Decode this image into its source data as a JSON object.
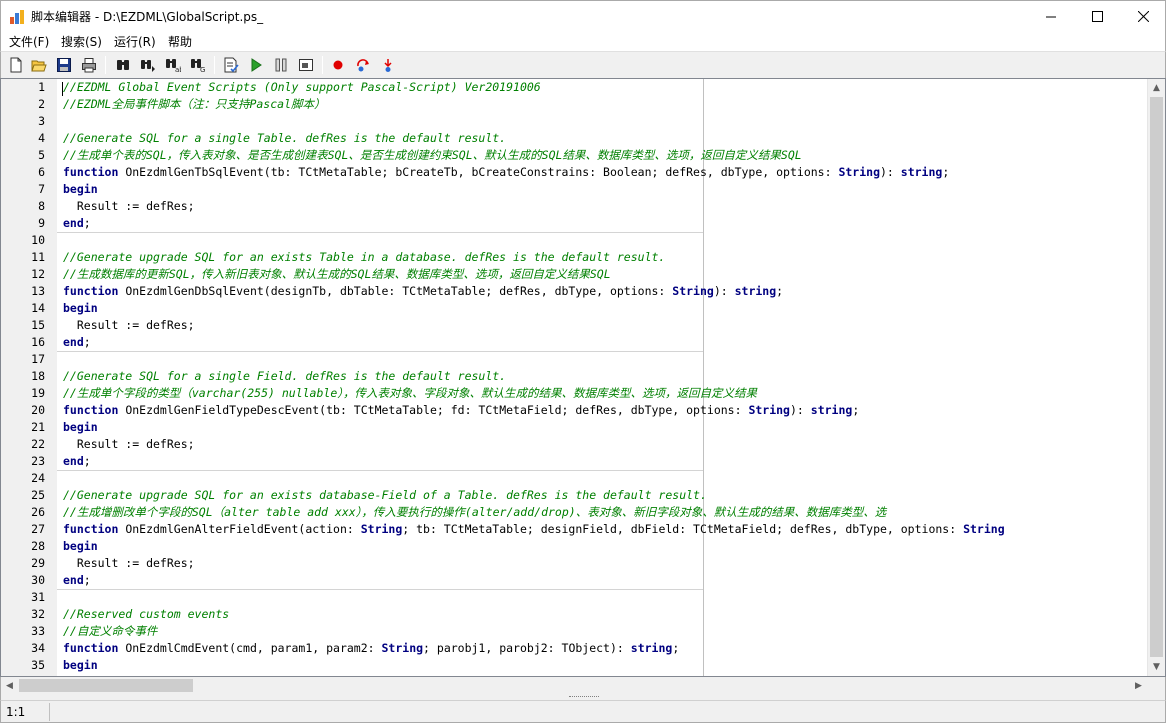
{
  "window": {
    "title": "脚本编辑器 - D:\\EZDML\\GlobalScript.ps_",
    "minimize_label": "—",
    "maximize_label": "☐",
    "close_label": "✕"
  },
  "menu": [
    {
      "label": "文件(F)"
    },
    {
      "label": "搜索(S)"
    },
    {
      "label": "运行(R)"
    },
    {
      "label": "帮助"
    }
  ],
  "toolbar": {
    "icons": [
      "new-file-icon",
      "open-folder-icon",
      "save-icon",
      "print-icon",
      "find-icon",
      "find-next-icon",
      "replace-icon",
      "goto-line-icon",
      "syntax-check-icon",
      "run-icon",
      "pause-icon",
      "step-into-icon",
      "breakpoint-icon",
      "step-over-icon",
      "trace-icon"
    ],
    "colors": {
      "run": "#2aa02a",
      "breakpoint": "#e00000"
    }
  },
  "editor": {
    "line_numbers": [
      "1",
      "2",
      "3",
      "4",
      "5",
      "6",
      "7",
      "8",
      "9",
      "10",
      "11",
      "12",
      "13",
      "14",
      "15",
      "16",
      "17",
      "18",
      "19",
      "20",
      "21",
      "22",
      "23",
      "24",
      "25",
      "26",
      "27",
      "28",
      "29",
      "30",
      "31",
      "32",
      "33",
      "34",
      "35"
    ],
    "lines": [
      {
        "comment": "//EZDML Global Event Scripts (Only support Pascal-Script) Ver20191006"
      },
      {
        "comment": "//EZDML全局事件脚本（注：只支持Pascal脚本）"
      },
      {
        "plain": ""
      },
      {
        "comment": "//Generate SQL for a single Table. defRes is the default result."
      },
      {
        "comment": "//生成单个表的SQL，传入表对象、是否生成创建表SQL、是否生成创建约束SQL、默认生成的SQL结果、数据库类型、选项，返回自定义结果SQL"
      },
      {
        "kw": "function",
        "plain": " OnEzdmlGenTbSqlEvent(tb: TCtMetaTable; bCreateTb, bCreateConstrains: Boolean; defRes, dbType, options: ",
        "kw2": "String",
        "plain2": "): ",
        "kw3": "string",
        "plain3": ";"
      },
      {
        "kw": "begin"
      },
      {
        "plain": "  Result := defRes;"
      },
      {
        "kw": "end",
        "plain": ";"
      },
      {
        "plain": ""
      },
      {
        "comment": "//Generate upgrade SQL for an exists Table in a database. defRes is the default result."
      },
      {
        "comment": "//生成数据库的更新SQL，传入新旧表对象、默认生成的SQL结果、数据库类型、选项，返回自定义结果SQL"
      },
      {
        "kw": "function",
        "plain": " OnEzdmlGenDbSqlEvent(designTb, dbTable: TCtMetaTable; defRes, dbType, options: ",
        "kw2": "String",
        "plain2": "): ",
        "kw3": "string",
        "plain3": ";"
      },
      {
        "kw": "begin"
      },
      {
        "plain": "  Result := defRes;"
      },
      {
        "kw": "end",
        "plain": ";"
      },
      {
        "plain": ""
      },
      {
        "comment": "//Generate SQL for a single Field. defRes is the default result."
      },
      {
        "comment": "//生成单个字段的类型（varchar(255) nullable），传入表对象、字段对象、默认生成的结果、数据库类型、选项，返回自定义结果"
      },
      {
        "kw": "function",
        "plain": " OnEzdmlGenFieldTypeDescEvent(tb: TCtMetaTable; fd: TCtMetaField; defRes, dbType, options: ",
        "kw2": "String",
        "plain2": "): ",
        "kw3": "string",
        "plain3": ";"
      },
      {
        "kw": "begin"
      },
      {
        "plain": "  Result := defRes;"
      },
      {
        "kw": "end",
        "plain": ";"
      },
      {
        "plain": ""
      },
      {
        "comment": "//Generate upgrade SQL for an exists database-Field of a Table. defRes is the default result."
      },
      {
        "comment": "//生成增删改单个字段的SQL（alter table add xxx），传入要执行的操作(alter/add/drop)、表对象、新旧字段对象、默认生成的结果、数据库类型、选"
      },
      {
        "kw": "function",
        "plain": " OnEzdmlGenAlterFieldEvent(action: ",
        "kw2": "String",
        "plain2": "; tb: TCtMetaTable; designField, dbField: TCtMetaField; defRes, dbType, options: ",
        "kw3": "String",
        "plain3": ""
      },
      {
        "kw": "begin"
      },
      {
        "plain": "  Result := defRes;"
      },
      {
        "kw": "end",
        "plain": ";"
      },
      {
        "plain": ""
      },
      {
        "comment": "//Reserved custom events"
      },
      {
        "comment": "//自定义命令事件"
      },
      {
        "kw": "function",
        "plain": " OnEzdmlCmdEvent(cmd, param1, param2: ",
        "kw2": "String",
        "plain2": "; parobj1, parobj2: TObject): ",
        "kw3": "string",
        "plain3": ";"
      },
      {
        "kw": "begin"
      }
    ]
  },
  "statusbar": {
    "position": "1:1"
  }
}
